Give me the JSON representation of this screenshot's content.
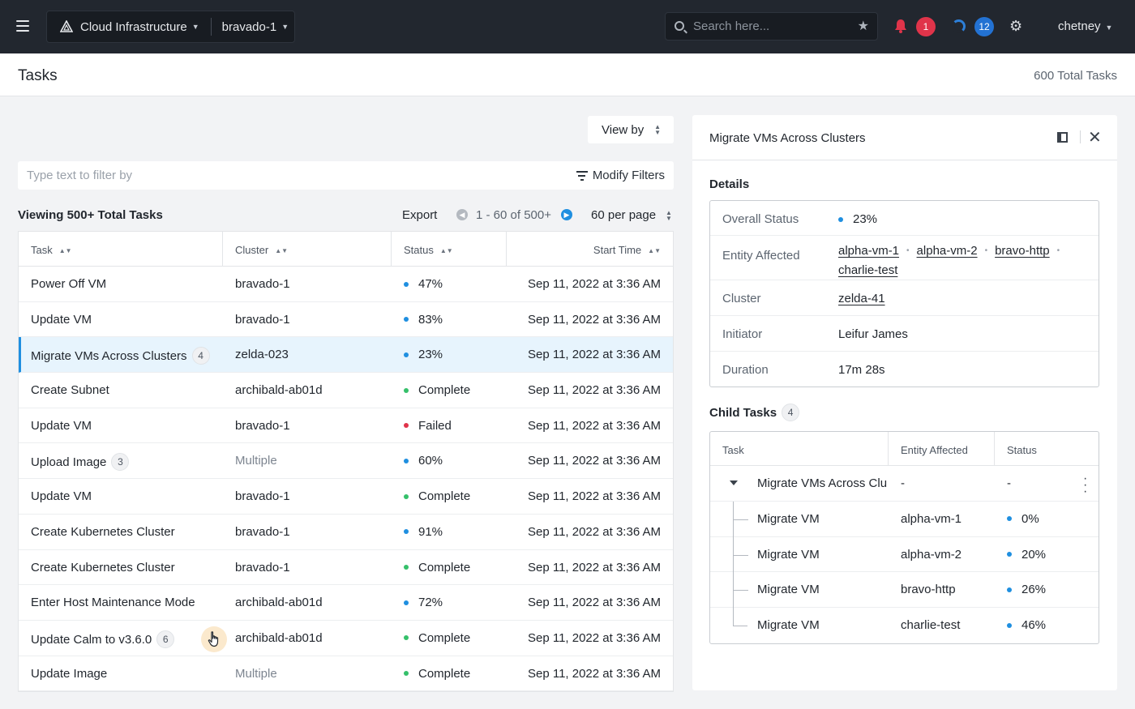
{
  "header": {
    "app_name": "Cloud Infrastructure",
    "cluster_name": "bravado-1",
    "search_placeholder": "Search here...",
    "alerts_count": "1",
    "tasks_count": "12",
    "user_name": "chetney",
    "colors": {
      "topbar": "#22272f",
      "alert_badge": "#e0344a",
      "task_badge": "#2372d3"
    }
  },
  "page": {
    "title": "Tasks",
    "total_label": "600 Total Tasks"
  },
  "toolbar": {
    "view_by_label": "View by",
    "filter_placeholder": "Type text to filter by",
    "modify_filters_label": "Modify Filters",
    "viewing_label": "Viewing 500+ Total Tasks",
    "export_label": "Export",
    "page_range": "1 - 60 of 500+",
    "per_page_label": "60 per page"
  },
  "tasks_table": {
    "columns": [
      "Task",
      "Cluster",
      "Status",
      "Start Time"
    ],
    "rows": [
      {
        "task": "Power Off VM",
        "count": "",
        "cluster": "bravado-1",
        "muted": false,
        "status": "47%",
        "status_color": "#1f8fe0",
        "time": "Sep 11, 2022 at 3:36 AM"
      },
      {
        "task": "Update VM",
        "count": "",
        "cluster": "bravado-1",
        "muted": false,
        "status": "83%",
        "status_color": "#1f8fe0",
        "time": "Sep 11, 2022 at 3:36 AM"
      },
      {
        "task": "Migrate VMs Across Clusters",
        "count": "4",
        "cluster": "zelda-023",
        "muted": false,
        "status": "23%",
        "status_color": "#1f8fe0",
        "time": "Sep 11, 2022 at 3:36 AM",
        "selected": true
      },
      {
        "task": "Create Subnet",
        "count": "",
        "cluster": "archibald-ab01d",
        "muted": false,
        "status": "Complete",
        "status_color": "#35c06a",
        "time": "Sep 11, 2022 at 3:36 AM"
      },
      {
        "task": "Update VM",
        "count": "",
        "cluster": "bravado-1",
        "muted": false,
        "status": "Failed",
        "status_color": "#e0344a",
        "time": "Sep 11, 2022 at 3:36 AM"
      },
      {
        "task": "Upload Image",
        "count": "3",
        "cluster": "Multiple",
        "muted": true,
        "status": "60%",
        "status_color": "#1f8fe0",
        "time": "Sep 11, 2022 at 3:36 AM"
      },
      {
        "task": "Update VM",
        "count": "",
        "cluster": "bravado-1",
        "muted": false,
        "status": "Complete",
        "status_color": "#35c06a",
        "time": "Sep 11, 2022 at 3:36 AM"
      },
      {
        "task": "Create Kubernetes Cluster",
        "count": "",
        "cluster": "bravado-1",
        "muted": false,
        "status": "91%",
        "status_color": "#1f8fe0",
        "time": "Sep 11, 2022 at 3:36 AM"
      },
      {
        "task": "Create Kubernetes Cluster",
        "count": "",
        "cluster": "bravado-1",
        "muted": false,
        "status": "Complete",
        "status_color": "#35c06a",
        "time": "Sep 11, 2022 at 3:36 AM"
      },
      {
        "task": "Enter Host Maintenance Mode",
        "count": "",
        "cluster": "archibald-ab01d",
        "muted": false,
        "status": "72%",
        "status_color": "#1f8fe0",
        "time": "Sep 11, 2022 at 3:36 AM"
      },
      {
        "task": "Update Calm to v3.6.0",
        "count": "6",
        "cluster": "archibald-ab01d",
        "muted": false,
        "status": "Complete",
        "status_color": "#35c06a",
        "time": "Sep 11, 2022 at 3:36 AM",
        "cursor": true
      },
      {
        "task": "Update Image",
        "count": "",
        "cluster": "Multiple",
        "muted": true,
        "status": "Complete",
        "status_color": "#35c06a",
        "time": "Sep 11, 2022 at 3:36 AM"
      }
    ]
  },
  "detail_panel": {
    "title": "Migrate VMs Across Clusters",
    "details_heading": "Details",
    "overall_status_label": "Overall Status",
    "overall_status": "23%",
    "entity_label": "Entity Affected",
    "entities": [
      "alpha-vm-1",
      "alpha-vm-2",
      "bravo-http",
      "charlie-test"
    ],
    "cluster_label": "Cluster",
    "cluster": "zelda-41",
    "initiator_label": "Initiator",
    "initiator": "Leifur James",
    "duration_label": "Duration",
    "duration": "17m 28s",
    "child_tasks_heading": "Child Tasks",
    "child_tasks_count": "4",
    "child_columns": [
      "Task",
      "Entity Affected",
      "Status"
    ],
    "parent_row": {
      "task": "Migrate VMs Across Clu",
      "entity": "-",
      "status": "-"
    },
    "child_rows": [
      {
        "task": "Migrate VM",
        "entity": "alpha-vm-1",
        "status": "0%"
      },
      {
        "task": "Migrate VM",
        "entity": "alpha-vm-2",
        "status": "20%"
      },
      {
        "task": "Migrate VM",
        "entity": "bravo-http",
        "status": "26%"
      },
      {
        "task": "Migrate VM",
        "entity": "charlie-test",
        "status": "46%"
      }
    ]
  }
}
